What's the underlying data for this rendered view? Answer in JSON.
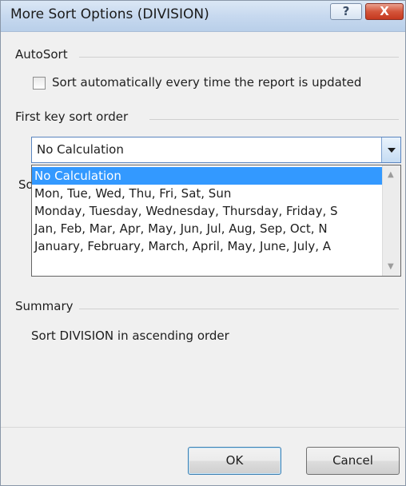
{
  "window": {
    "title": "More Sort Options (DIVISION)",
    "help_label": "?",
    "close_label": "X"
  },
  "autosort": {
    "section_label": "AutoSort",
    "checkbox_label": "Sort automatically every time the report is updated",
    "checked": false
  },
  "first_key": {
    "section_label": "First key sort order",
    "selected": "No Calculation",
    "options": [
      "No Calculation",
      "Mon, Tue, Wed, Thu, Fri, Sat, Sun",
      "Monday, Tuesday, Wednesday, Thursday, Friday, S",
      "Jan, Feb, Mar, Apr, May, Jun, Jul, Aug, Sep, Oct, N",
      "January, February, March, April, May, June, July, A"
    ]
  },
  "sort_by": {
    "partial_label": "So"
  },
  "summary": {
    "section_label": "Summary",
    "text": "Sort DIVISION in ascending order"
  },
  "buttons": {
    "ok": "OK",
    "cancel": "Cancel"
  }
}
